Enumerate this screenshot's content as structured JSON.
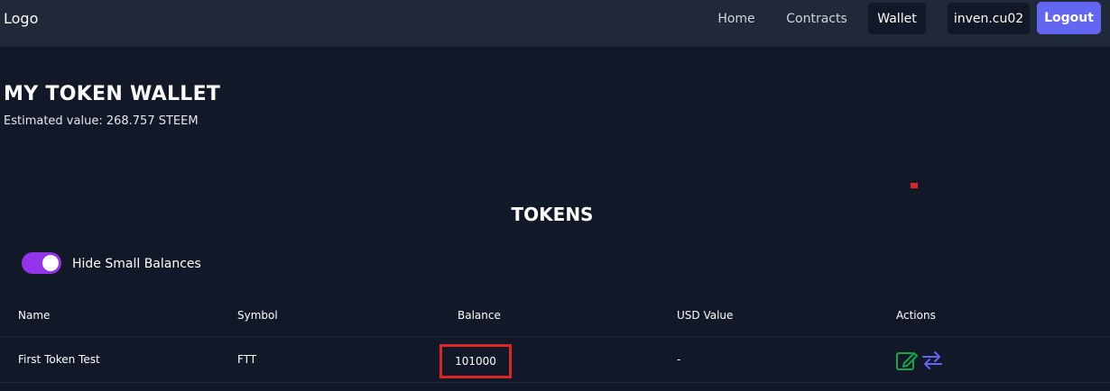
{
  "navbar": {
    "logo": "Logo",
    "links": [
      {
        "label": "Home"
      },
      {
        "label": "Contracts"
      },
      {
        "label": "Wallet"
      }
    ],
    "user": "inven.cu02",
    "logout_label": "Logout"
  },
  "wallet": {
    "title": "MY TOKEN WALLET",
    "estimated_value": "Estimated value: 268.757 STEEM"
  },
  "tokens": {
    "title": "TOKENS",
    "toggle_label": "Hide Small Balances",
    "toggle_on": true,
    "columns": [
      "Name",
      "Symbol",
      "Balance",
      "USD Value",
      "Actions"
    ],
    "rows": [
      {
        "name": "First Token Test",
        "symbol": "FTT",
        "balance": "101000",
        "usd_value": "-"
      }
    ]
  },
  "colors": {
    "background": "#111827",
    "navbar": "#1f2937",
    "accent": "#6366f1",
    "toggle": "#9333ea",
    "highlight": "#dc2626",
    "edit_icon": "#16a34a",
    "transfer_icon": "#6366f1"
  },
  "icons": [
    "edit-icon",
    "transfer-icon"
  ]
}
